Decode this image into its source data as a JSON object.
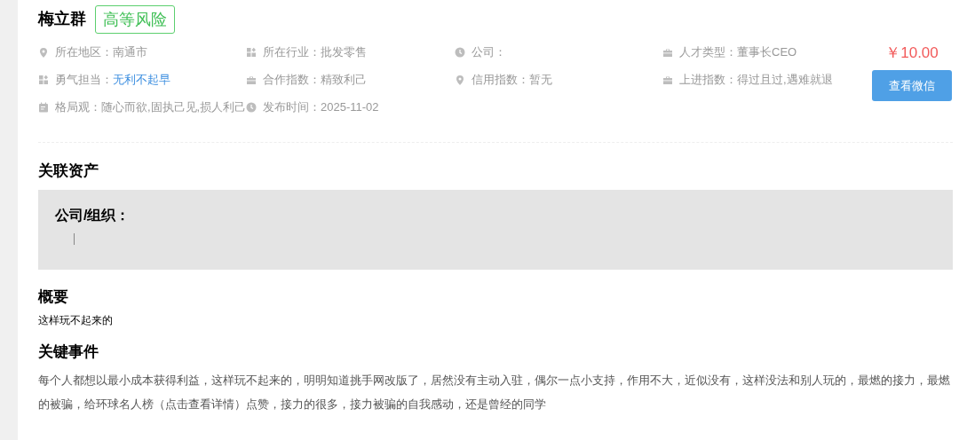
{
  "profile": {
    "name": "梅立群",
    "risk_badge": "高等风险"
  },
  "info": [
    {
      "kind": "pin",
      "label": "所在地区：",
      "value": "南通市",
      "highlighted": false
    },
    {
      "kind": "grid",
      "label": "所在行业：",
      "value": "批发零售",
      "highlighted": false
    },
    {
      "kind": "clock",
      "label": "公司：",
      "highlighted": false
    },
    {
      "kind": "briefcase",
      "label": "人才类型：",
      "value": "董事长CEO",
      "highlighted": false
    },
    {
      "kind": "grid",
      "label": "勇气担当：",
      "value": "无利不起早",
      "highlighted": true
    },
    {
      "kind": "briefcase",
      "label": "合作指数：",
      "value": "精致利己",
      "highlighted": false
    },
    {
      "kind": "pin",
      "label": "信用指数：",
      "value": "暂无",
      "highlighted": false
    },
    {
      "kind": "briefcase",
      "label": "上进指数：",
      "value": "得过且过,遇难就退",
      "highlighted": false
    },
    {
      "kind": "calendar",
      "label": "格局观：",
      "value": "随心而欲,固执己见,损人利己",
      "highlighted": false
    },
    {
      "kind": "clock",
      "label": "发布时间：",
      "value": "2025-11-02",
      "highlighted": false
    }
  ],
  "price": "￥10.00",
  "view_wechat_button": "查看微信",
  "assets": {
    "title": "关联资产",
    "label": "公司/组织："
  },
  "summary": {
    "title": "概要",
    "text": "这样玩不起来的"
  },
  "events": {
    "title": "关键事件",
    "text": "每个人都想以最小成本获得利益，这样玩不起来的，明明知道挑手网改版了，居然没有主动入驻，偶尔一点小支持，作用不大，近似没有，这样没法和别人玩的，最燃的接力，最燃的被骗，给环球名人榜（点击查看详情）点赞，接力的很多，接力被骗的自我感动，还是曾经的同学"
  }
}
